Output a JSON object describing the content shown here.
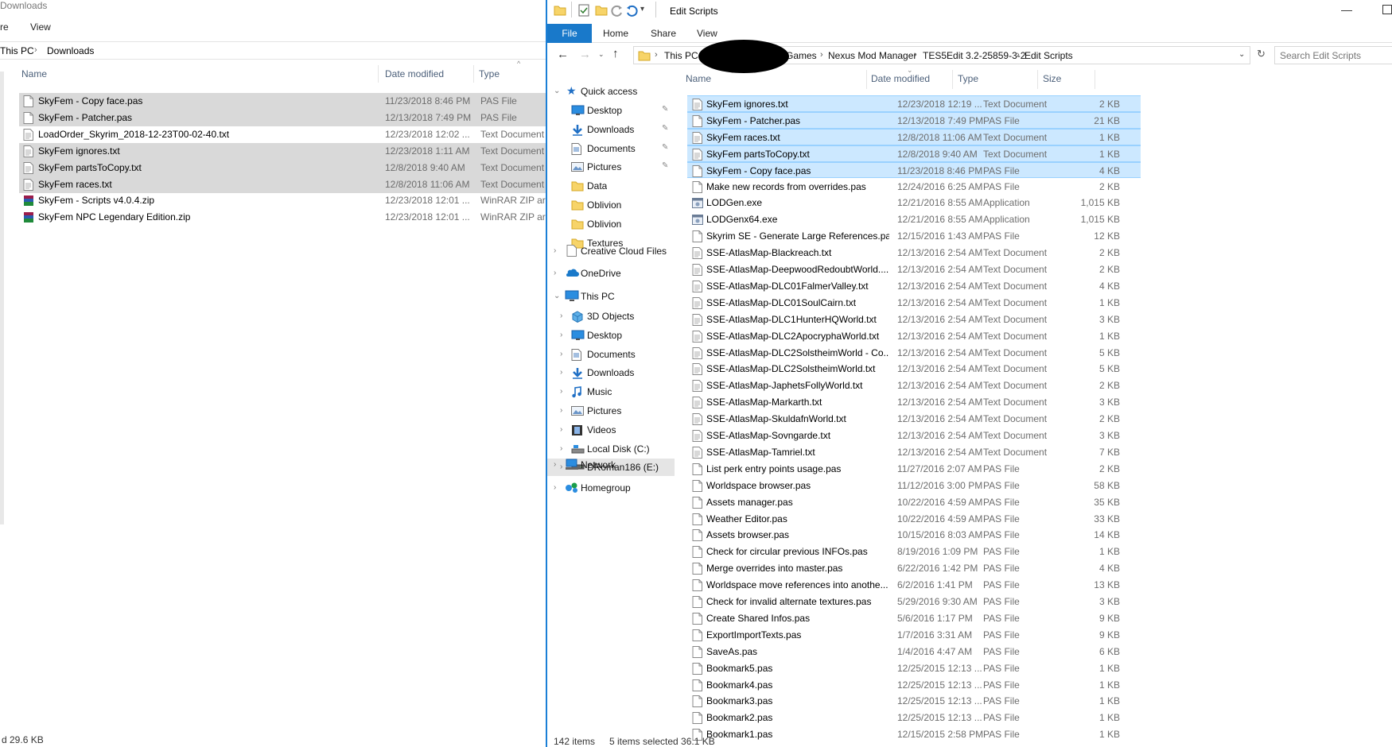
{
  "left": {
    "title": "Downloads",
    "ribbon": [
      "re",
      "View"
    ],
    "breadcrumb": [
      "This PC",
      "Downloads"
    ],
    "columns": [
      "Name",
      "Date modified",
      "Type"
    ],
    "files": [
      {
        "name": "SkyFem - Copy face.pas",
        "date": "11/23/2018 8:46 PM",
        "type": "PAS File",
        "icon": "file-icon",
        "selected": true
      },
      {
        "name": "SkyFem - Patcher.pas",
        "date": "12/13/2018 7:49 PM",
        "type": "PAS File",
        "icon": "file-icon",
        "selected": true
      },
      {
        "name": "LoadOrder_Skyrim_2018-12-23T00-02-40.txt",
        "date": "12/23/2018 12:02 ...",
        "type": "Text Document",
        "icon": "text-file-icon",
        "selected": false
      },
      {
        "name": "SkyFem ignores.txt",
        "date": "12/23/2018 1:11 AM",
        "type": "Text Document",
        "icon": "text-file-icon",
        "selected": true
      },
      {
        "name": "SkyFem partsToCopy.txt",
        "date": "12/8/2018 9:40 AM",
        "type": "Text Document",
        "icon": "text-file-icon",
        "selected": true
      },
      {
        "name": "SkyFem races.txt",
        "date": "12/8/2018 11:06 AM",
        "type": "Text Document",
        "icon": "text-file-icon",
        "selected": true
      },
      {
        "name": "SkyFem - Scripts v4.0.4.zip",
        "date": "12/23/2018 12:01 ...",
        "type": "WinRAR ZIP arc",
        "icon": "winrar-archive-icon",
        "selected": false
      },
      {
        "name": "SkyFem NPC Legendary Edition.zip",
        "date": "12/23/2018 12:01 ...",
        "type": "WinRAR ZIP arc",
        "icon": "winrar-archive-icon",
        "selected": false
      }
    ],
    "status": "d  29.6 KB"
  },
  "right": {
    "title": "Edit Scripts",
    "ribbon": {
      "file": "File",
      "tabs": [
        "Home",
        "Share",
        "View"
      ]
    },
    "breadcrumb": [
      "This PC",
      "Games",
      "Nexus Mod Manager",
      "TES5Edit 3.2-25859-3-2",
      "Edit Scripts"
    ],
    "search_placeholder": "Search Edit Scripts",
    "nav": {
      "quick_access": "Quick access",
      "quick_items": [
        {
          "label": "Desktop",
          "icon": "desktop-icon",
          "pinned": true
        },
        {
          "label": "Downloads",
          "icon": "download-icon",
          "pinned": true
        },
        {
          "label": "Documents",
          "icon": "documents-icon",
          "pinned": true
        },
        {
          "label": "Pictures",
          "icon": "pictures-icon",
          "pinned": true
        },
        {
          "label": "Data",
          "icon": "folder-icon",
          "pinned": false
        },
        {
          "label": "Oblivion",
          "icon": "folder-icon",
          "pinned": false
        },
        {
          "label": "Oblivion",
          "icon": "folder-icon",
          "pinned": false
        },
        {
          "label": "Textures",
          "icon": "folder-icon",
          "pinned": false
        }
      ],
      "creative_cloud": "Creative Cloud Files",
      "onedrive": "OneDrive",
      "this_pc": "This PC",
      "pc_items": [
        {
          "label": "3D Objects",
          "icon": "cube-icon"
        },
        {
          "label": "Desktop",
          "icon": "desktop-icon"
        },
        {
          "label": "Documents",
          "icon": "documents-icon"
        },
        {
          "label": "Downloads",
          "icon": "download-icon"
        },
        {
          "label": "Music",
          "icon": "music-icon"
        },
        {
          "label": "Pictures",
          "icon": "pictures-icon"
        },
        {
          "label": "Videos",
          "icon": "videos-icon"
        },
        {
          "label": "Local Disk (C:)",
          "icon": "local-disk-icon"
        },
        {
          "label": "DRoman186 (E:)",
          "icon": "drive-icon"
        }
      ],
      "network": "Network",
      "homegroup": "Homegroup"
    },
    "columns": [
      "Name",
      "Date modified",
      "Type",
      "Size"
    ],
    "files": [
      {
        "name": "SkyFem ignores.txt",
        "date": "12/23/2018 12:19 ...",
        "type": "Text Document",
        "size": "2 KB",
        "icon": "text-file-icon",
        "selected": true
      },
      {
        "name": "SkyFem - Patcher.pas",
        "date": "12/13/2018 7:49 PM",
        "type": "PAS File",
        "size": "21 KB",
        "icon": "file-icon",
        "selected": true
      },
      {
        "name": "SkyFem races.txt",
        "date": "12/8/2018 11:06 AM",
        "type": "Text Document",
        "size": "1 KB",
        "icon": "text-file-icon",
        "selected": true
      },
      {
        "name": "SkyFem partsToCopy.txt",
        "date": "12/8/2018 9:40 AM",
        "type": "Text Document",
        "size": "1 KB",
        "icon": "text-file-icon",
        "selected": true
      },
      {
        "name": "SkyFem - Copy face.pas",
        "date": "11/23/2018 8:46 PM",
        "type": "PAS File",
        "size": "4 KB",
        "icon": "file-icon",
        "selected": true
      },
      {
        "name": "Make new records from overrides.pas",
        "date": "12/24/2016 6:25 AM",
        "type": "PAS File",
        "size": "2 KB",
        "icon": "file-icon",
        "selected": false
      },
      {
        "name": "LODGen.exe",
        "date": "12/21/2016 8:55 AM",
        "type": "Application",
        "size": "1,015 KB",
        "icon": "app-icon",
        "selected": false
      },
      {
        "name": "LODGenx64.exe",
        "date": "12/21/2016 8:55 AM",
        "type": "Application",
        "size": "1,015 KB",
        "icon": "app-icon",
        "selected": false
      },
      {
        "name": "Skyrim SE - Generate Large References.pas",
        "date": "12/15/2016 1:43 AM",
        "type": "PAS File",
        "size": "12 KB",
        "icon": "file-icon",
        "selected": false
      },
      {
        "name": "SSE-AtlasMap-Blackreach.txt",
        "date": "12/13/2016 2:54 AM",
        "type": "Text Document",
        "size": "2 KB",
        "icon": "text-file-icon",
        "selected": false
      },
      {
        "name": "SSE-AtlasMap-DeepwoodRedoubtWorld....",
        "date": "12/13/2016 2:54 AM",
        "type": "Text Document",
        "size": "2 KB",
        "icon": "text-file-icon",
        "selected": false
      },
      {
        "name": "SSE-AtlasMap-DLC01FalmerValley.txt",
        "date": "12/13/2016 2:54 AM",
        "type": "Text Document",
        "size": "4 KB",
        "icon": "text-file-icon",
        "selected": false
      },
      {
        "name": "SSE-AtlasMap-DLC01SoulCairn.txt",
        "date": "12/13/2016 2:54 AM",
        "type": "Text Document",
        "size": "1 KB",
        "icon": "text-file-icon",
        "selected": false
      },
      {
        "name": "SSE-AtlasMap-DLC1HunterHQWorld.txt",
        "date": "12/13/2016 2:54 AM",
        "type": "Text Document",
        "size": "3 KB",
        "icon": "text-file-icon",
        "selected": false
      },
      {
        "name": "SSE-AtlasMap-DLC2ApocryphaWorld.txt",
        "date": "12/13/2016 2:54 AM",
        "type": "Text Document",
        "size": "1 KB",
        "icon": "text-file-icon",
        "selected": false
      },
      {
        "name": "SSE-AtlasMap-DLC2SolstheimWorld - Co...",
        "date": "12/13/2016 2:54 AM",
        "type": "Text Document",
        "size": "5 KB",
        "icon": "text-file-icon",
        "selected": false
      },
      {
        "name": "SSE-AtlasMap-DLC2SolstheimWorld.txt",
        "date": "12/13/2016 2:54 AM",
        "type": "Text Document",
        "size": "5 KB",
        "icon": "text-file-icon",
        "selected": false
      },
      {
        "name": "SSE-AtlasMap-JaphetsFollyWorld.txt",
        "date": "12/13/2016 2:54 AM",
        "type": "Text Document",
        "size": "2 KB",
        "icon": "text-file-icon",
        "selected": false
      },
      {
        "name": "SSE-AtlasMap-Markarth.txt",
        "date": "12/13/2016 2:54 AM",
        "type": "Text Document",
        "size": "3 KB",
        "icon": "text-file-icon",
        "selected": false
      },
      {
        "name": "SSE-AtlasMap-SkuldafnWorld.txt",
        "date": "12/13/2016 2:54 AM",
        "type": "Text Document",
        "size": "2 KB",
        "icon": "text-file-icon",
        "selected": false
      },
      {
        "name": "SSE-AtlasMap-Sovngarde.txt",
        "date": "12/13/2016 2:54 AM",
        "type": "Text Document",
        "size": "3 KB",
        "icon": "text-file-icon",
        "selected": false
      },
      {
        "name": "SSE-AtlasMap-Tamriel.txt",
        "date": "12/13/2016 2:54 AM",
        "type": "Text Document",
        "size": "7 KB",
        "icon": "text-file-icon",
        "selected": false
      },
      {
        "name": "List perk entry points usage.pas",
        "date": "11/27/2016 2:07 AM",
        "type": "PAS File",
        "size": "2 KB",
        "icon": "file-icon",
        "selected": false
      },
      {
        "name": "Worldspace browser.pas",
        "date": "11/12/2016 3:00 PM",
        "type": "PAS File",
        "size": "58 KB",
        "icon": "file-icon",
        "selected": false
      },
      {
        "name": "Assets manager.pas",
        "date": "10/22/2016 4:59 AM",
        "type": "PAS File",
        "size": "35 KB",
        "icon": "file-icon",
        "selected": false
      },
      {
        "name": "Weather Editor.pas",
        "date": "10/22/2016 4:59 AM",
        "type": "PAS File",
        "size": "33 KB",
        "icon": "file-icon",
        "selected": false
      },
      {
        "name": "Assets browser.pas",
        "date": "10/15/2016 8:03 AM",
        "type": "PAS File",
        "size": "14 KB",
        "icon": "file-icon",
        "selected": false
      },
      {
        "name": "Check for circular previous INFOs.pas",
        "date": "8/19/2016 1:09 PM",
        "type": "PAS File",
        "size": "1 KB",
        "icon": "file-icon",
        "selected": false
      },
      {
        "name": "Merge overrides into master.pas",
        "date": "6/22/2016 1:42 PM",
        "type": "PAS File",
        "size": "4 KB",
        "icon": "file-icon",
        "selected": false
      },
      {
        "name": "Worldspace move references into anothe...",
        "date": "6/2/2016 1:41 PM",
        "type": "PAS File",
        "size": "13 KB",
        "icon": "file-icon",
        "selected": false
      },
      {
        "name": "Check for invalid alternate textures.pas",
        "date": "5/29/2016 9:30 AM",
        "type": "PAS File",
        "size": "3 KB",
        "icon": "file-icon",
        "selected": false
      },
      {
        "name": "Create Shared Infos.pas",
        "date": "5/6/2016 1:17 PM",
        "type": "PAS File",
        "size": "9 KB",
        "icon": "file-icon",
        "selected": false
      },
      {
        "name": "ExportImportTexts.pas",
        "date": "1/7/2016 3:31 AM",
        "type": "PAS File",
        "size": "9 KB",
        "icon": "file-icon",
        "selected": false
      },
      {
        "name": "SaveAs.pas",
        "date": "1/4/2016 4:47 AM",
        "type": "PAS File",
        "size": "6 KB",
        "icon": "file-icon",
        "selected": false
      },
      {
        "name": "Bookmark5.pas",
        "date": "12/25/2015 12:13 ...",
        "type": "PAS File",
        "size": "1 KB",
        "icon": "file-icon",
        "selected": false
      },
      {
        "name": "Bookmark4.pas",
        "date": "12/25/2015 12:13 ...",
        "type": "PAS File",
        "size": "1 KB",
        "icon": "file-icon",
        "selected": false
      },
      {
        "name": "Bookmark3.pas",
        "date": "12/25/2015 12:13 ...",
        "type": "PAS File",
        "size": "1 KB",
        "icon": "file-icon",
        "selected": false
      },
      {
        "name": "Bookmark2.pas",
        "date": "12/25/2015 12:13 ...",
        "type": "PAS File",
        "size": "1 KB",
        "icon": "file-icon",
        "selected": false
      },
      {
        "name": "Bookmark1.pas",
        "date": "12/15/2015 2:58 PM",
        "type": "PAS File",
        "size": "1 KB",
        "icon": "file-icon",
        "selected": false
      }
    ],
    "status": {
      "items": "142 items",
      "selected": "5 items selected  36.1 KB"
    }
  },
  "colors": {
    "accent": "#1979ca",
    "selection": "#cce8ff",
    "left_selection": "#d9d9d9",
    "folder": "#f7d469"
  }
}
